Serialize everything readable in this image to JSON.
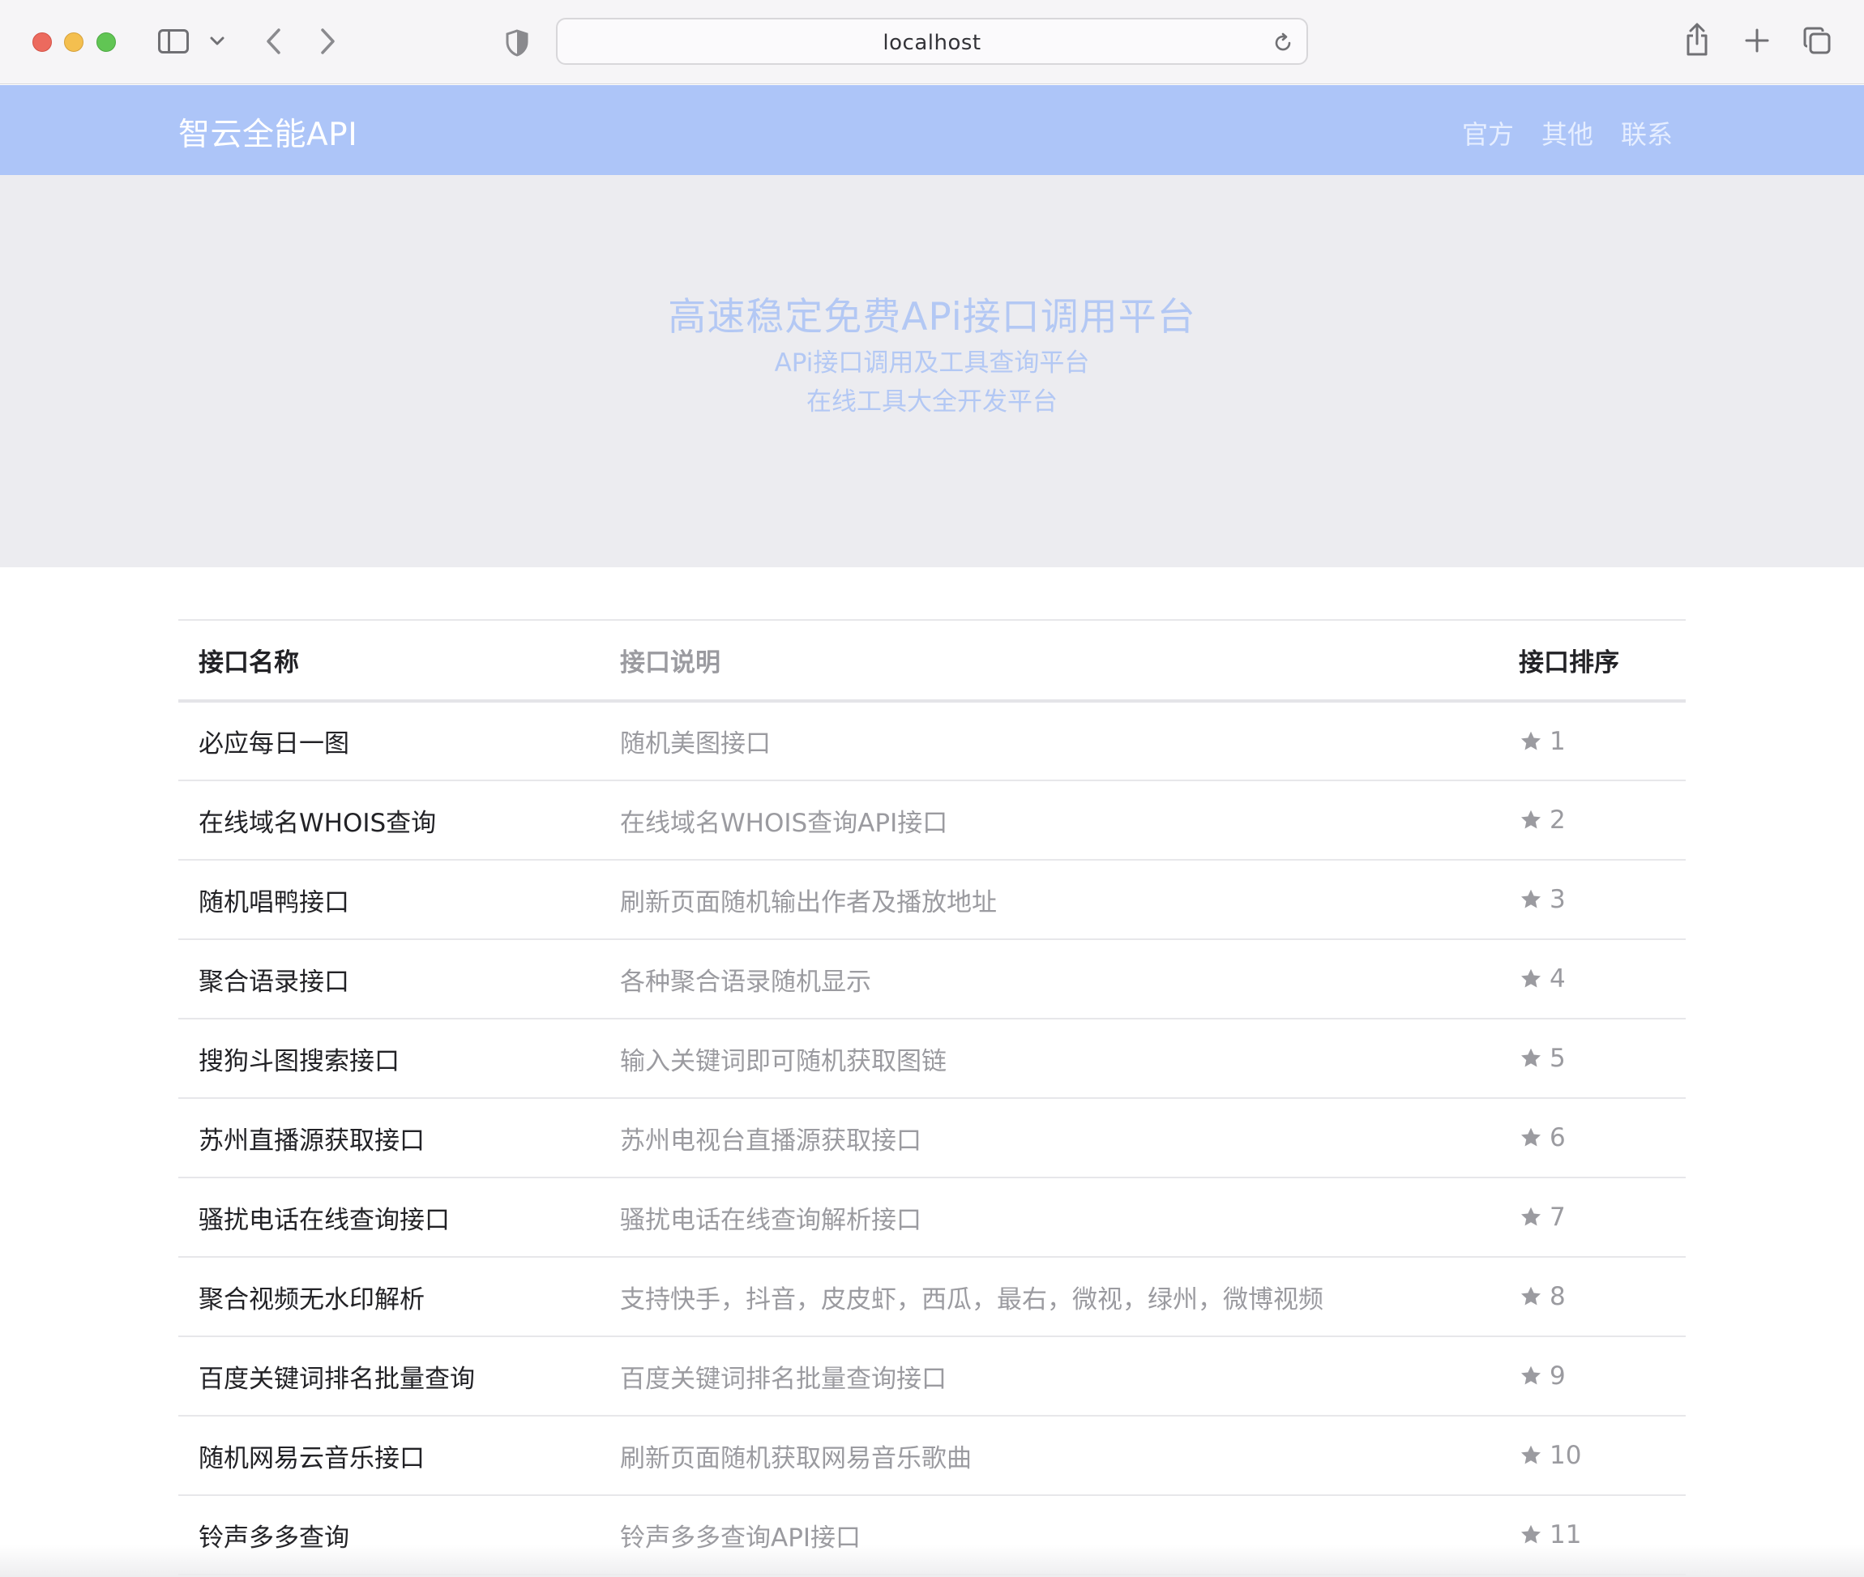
{
  "browser": {
    "url": "localhost"
  },
  "header": {
    "brand": "智云全能API",
    "nav": [
      {
        "label": "官方"
      },
      {
        "label": "其他"
      },
      {
        "label": "联系"
      }
    ]
  },
  "hero": {
    "title": "高速稳定免费APi接口调用平台",
    "subtitle1": "APi接口调用及工具查询平台",
    "subtitle2": "在线工具大全开发平台"
  },
  "table": {
    "columns": {
      "name": "接口名称",
      "desc": "接口说明",
      "rank": "接口排序"
    },
    "rows": [
      {
        "name": "必应每日一图",
        "desc": "随机美图接口",
        "rank": "1"
      },
      {
        "name": "在线域名WHOIS查询",
        "desc": "在线域名WHOIS查询API接口",
        "rank": "2"
      },
      {
        "name": "随机唱鸭接口",
        "desc": "刷新页面随机输出作者及播放地址",
        "rank": "3"
      },
      {
        "name": "聚合语录接口",
        "desc": "各种聚合语录随机显示",
        "rank": "4"
      },
      {
        "name": "搜狗斗图搜索接口",
        "desc": "输入关键词即可随机获取图链",
        "rank": "5"
      },
      {
        "name": "苏州直播源获取接口",
        "desc": "苏州电视台直播源获取接口",
        "rank": "6"
      },
      {
        "name": "骚扰电话在线查询接口",
        "desc": "骚扰电话在线查询解析接口",
        "rank": "7"
      },
      {
        "name": "聚合视频无水印解析",
        "desc": "支持快手，抖音，皮皮虾，西瓜，最右，微视，绿州，微博视频",
        "rank": "8"
      },
      {
        "name": "百度关键词排名批量查询",
        "desc": "百度关键词排名批量查询接口",
        "rank": "9"
      },
      {
        "name": "随机网易云音乐接口",
        "desc": "刷新页面随机获取网易音乐歌曲",
        "rank": "10"
      },
      {
        "name": "铃声多多查询",
        "desc": "铃声多多查询API接口",
        "rank": "11"
      }
    ]
  },
  "colors": {
    "header_bg": "#adc5f8",
    "hero_bg": "#ececf0",
    "hero_text": "#b3c8f4",
    "muted_text": "#9b9ba0"
  },
  "icons": {
    "rank": "star-icon"
  }
}
